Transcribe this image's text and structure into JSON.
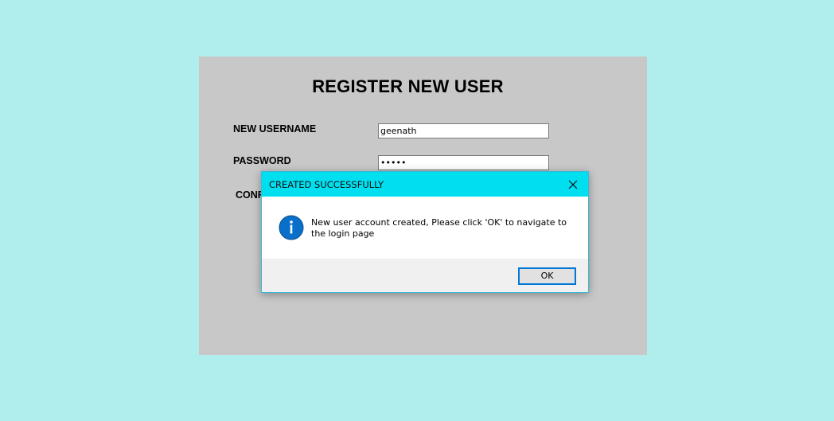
{
  "register_form": {
    "title": "REGISTER NEW USER",
    "username_label": "NEW USERNAME",
    "username_value": "geenath",
    "password_label": "PASSWORD",
    "password_value": "•••••",
    "confirm_label_visible": "CONF"
  },
  "dialog": {
    "title": "CREATED SUCCESSFULLY",
    "message": "New user account created, Please click 'OK' to navigate to the login page",
    "ok_label": "OK",
    "icon": "info-icon",
    "close_icon": "close-icon"
  },
  "colors": {
    "background": "#b0eded",
    "panel": "#c8c8c8",
    "dialog_titlebar": "#00dff0",
    "info_icon": "#0a6fc8",
    "button_border": "#0078d7"
  }
}
